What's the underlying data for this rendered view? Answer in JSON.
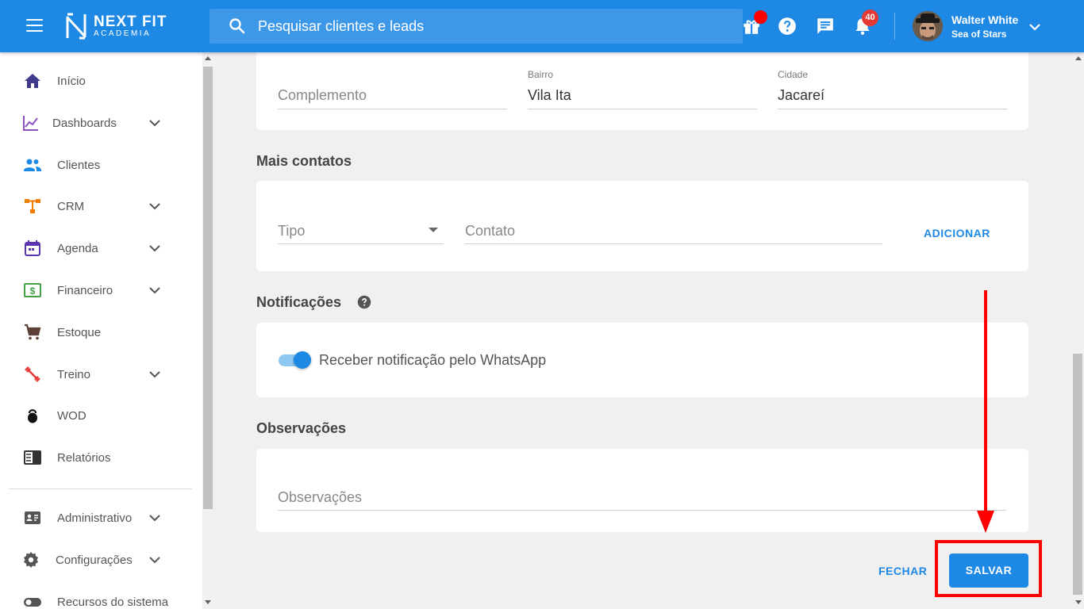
{
  "colors": {
    "primary": "#1e88e5",
    "highlight": "#ff0000",
    "badge": "#e53935"
  },
  "header": {
    "logo_line1": "NEXT FIT",
    "logo_line2": "ACADEMIA",
    "search_placeholder": "Pesquisar clientes e leads",
    "notification_count": "40",
    "user_name": "Walter White",
    "user_org": "Sea of Stars"
  },
  "sidebar": {
    "items": [
      {
        "label": "Início",
        "icon": "home-icon"
      },
      {
        "label": "Dashboards",
        "icon": "chart-icon"
      },
      {
        "label": "Clientes",
        "icon": "people-icon"
      },
      {
        "label": "CRM",
        "icon": "crm-icon"
      },
      {
        "label": "Agenda",
        "icon": "calendar-icon"
      },
      {
        "label": "Financeiro",
        "icon": "money-icon"
      },
      {
        "label": "Estoque",
        "icon": "cart-icon"
      },
      {
        "label": "Treino",
        "icon": "dumbbell-icon"
      },
      {
        "label": "WOD",
        "icon": "kettlebell-icon"
      },
      {
        "label": "Relatórios",
        "icon": "report-icon"
      },
      {
        "label": "Administrativo",
        "icon": "id-card-icon"
      },
      {
        "label": "Configurações",
        "icon": "gear-icon"
      },
      {
        "label": "Recursos do sistema",
        "icon": "toggle-icon"
      }
    ]
  },
  "address": {
    "complemento_placeholder": "Complemento",
    "bairro_label": "Bairro",
    "bairro_value": "Vila Ita",
    "cidade_label": "Cidade",
    "cidade_value": "Jacareí"
  },
  "contacts": {
    "title": "Mais contatos",
    "tipo_placeholder": "Tipo",
    "contato_placeholder": "Contato",
    "add_label": "ADICIONAR"
  },
  "notifications": {
    "title": "Notificações",
    "whatsapp_label": "Receber notificação pelo WhatsApp",
    "whatsapp_enabled": true
  },
  "observations": {
    "title": "Observações",
    "placeholder": "Observações"
  },
  "actions": {
    "close_label": "FECHAR",
    "save_label": "SALVAR"
  }
}
